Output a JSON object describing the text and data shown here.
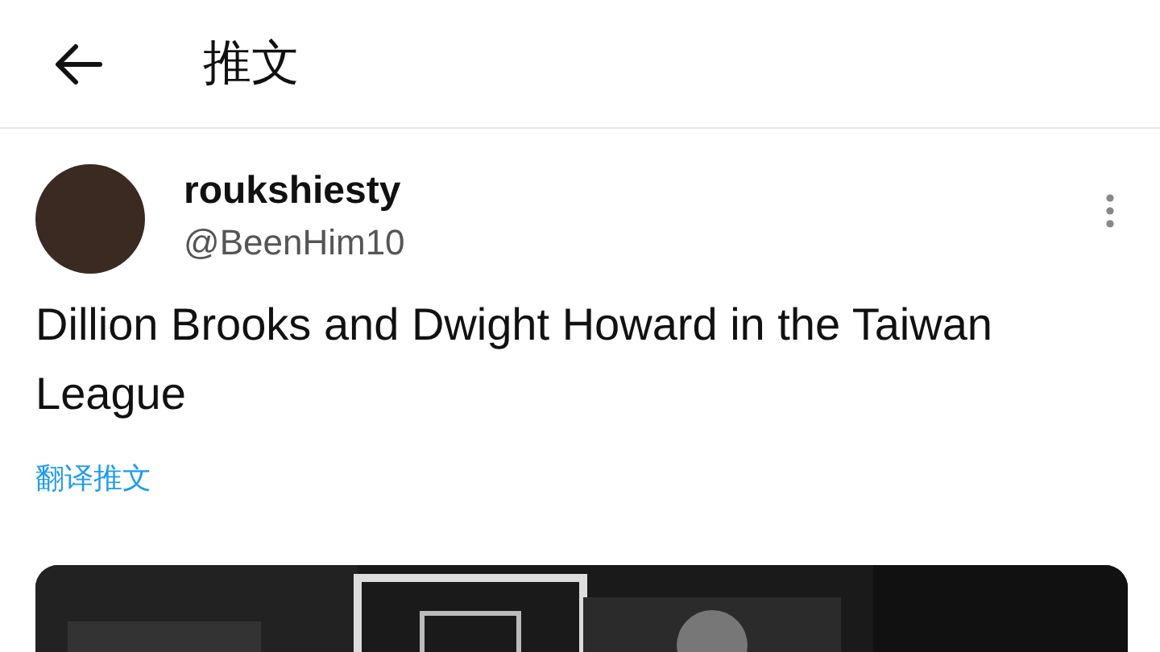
{
  "header": {
    "title": "推文"
  },
  "tweet": {
    "display_name": "roukshiesty",
    "handle": "@BeenHim10",
    "text": "Dillion Brooks and Dwight Howard in the Taiwan League",
    "translate_link": "翻译推文"
  }
}
